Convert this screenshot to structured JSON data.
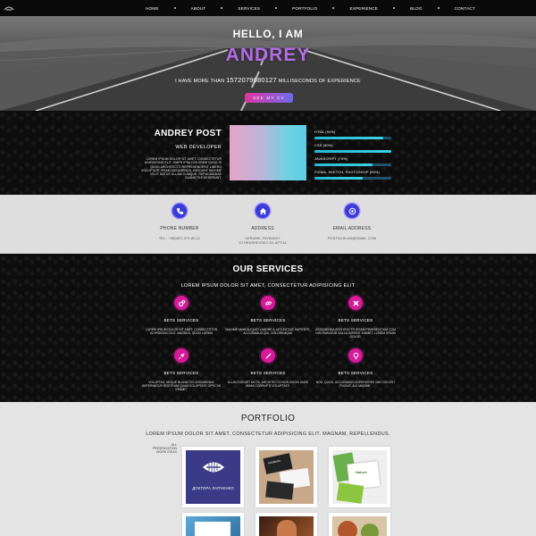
{
  "nav": {
    "items": [
      "HOME",
      "ABOUT",
      "SERVICES",
      "PORTFOLIO",
      "EXPERIENCE",
      "BLOG",
      "CONTACT"
    ]
  },
  "hero": {
    "greeting": "HELLO, I AM",
    "name": "ANDREY",
    "experience_prefix": "I HAVE MORE THAN",
    "experience_number": "1572079080127",
    "experience_suffix": "MILLISECONDS OF EXPERIENCE",
    "cv_button": "SEE MY CV"
  },
  "about": {
    "name": "ANDREY POST",
    "role": "WEB DEVELOPER",
    "text": "LOREM IPSUM DOLOR SIT AMET, CONSECTETUR ADIPISICING ELIT. OMPR IPSA DOLOREM QUOS SI QUOD ARCHITECTO REPREHENDERIT LIBERO VOLUPTATE IPSAM ASSUMENDA, INCIDUNT MAXIME VELIT NATUS ULLAM CUMQUE, REPUDIANDAE BLANDITIIS DESERUNT.",
    "skills": [
      {
        "label": "HTML (90%)",
        "level": 0.9
      },
      {
        "label": "CSS (80%)",
        "level": 1.0
      },
      {
        "label": "JAVASCRIPT (75%)",
        "level": 0.75
      },
      {
        "label": "FIGMA, SKETCH, PHOTOSHOP (90%)",
        "level": 0.63
      }
    ]
  },
  "contact": {
    "items": [
      {
        "title": "PHONE NUMBER",
        "value": "TEL.: +38(067) 079-80-12",
        "icon": "phone-icon"
      },
      {
        "title": "ADDRESS",
        "value": "UKRAINE, RIVNVASY\nST.HRUSHEVSKY 23, APT.34",
        "icon": "home-icon"
      },
      {
        "title": "EMAIL ADDRESS",
        "value": "POSTILKIN.AN@GMAIL.COM",
        "icon": "target-icon"
      }
    ]
  },
  "services": {
    "title": "OUR SERVICES",
    "subtitle": "LOREM IPSUM DOLOR SIT AMET, CONSECTETUR ADIPISICING ELIT",
    "items": [
      {
        "title": "BETS SERVICES",
        "desc": "LOREM IPSUM DOLOR SIT AMET, CONSECTETUR ADIPISICING ELIT. MAGNES, QUOD LOREM",
        "icon": "gears-icon"
      },
      {
        "title": "BETS SERVICES",
        "desc": "MAXIME AMIM ALIQUID LANDRE A, MOLESTIAE SAPIENTE, ACCUSAMUS QUI, OOLOREMQUE",
        "icon": "link-icon"
      },
      {
        "title": "BETS SERVICES",
        "desc": "ASSUMENDA ARCHITECTO IPSAM PRAESENTIUM COM NISI PARIATUR NULLA IMPEDIT ENIMET, LOREM IPSUM DOLOR.",
        "icon": "cross-icon"
      },
      {
        "title": "BETS SERVICES",
        "desc": "VOLUPTAS, NEQUE BLANDITIIS ASSUMENDA ASPERNATUR ROSTRUM QUAM VOLUPTATE OFFICIIS ENIMET.",
        "icon": "rocket-icon"
      },
      {
        "title": "BETS SERVICES",
        "desc": "ILLUM EVENIET DICTA, ARCHITECTO NON DIXON UNDE ANIMI CORRUPTI VOLUPTATE.",
        "icon": "pen-icon"
      },
      {
        "title": "BETS SERVICES",
        "desc": "NOS, QUOD. ACCUSAMUS ASPERIORES SIM CON EST FUGUIT. ALII MAXIME.",
        "icon": "bulb-icon"
      }
    ]
  },
  "portfolio": {
    "title": "PORTFOLIO",
    "subtitle": "LOREM IPSUM DOLOR SIT AMET, CONSECTETUR ADIPISICING ELIT. MAGNAM, REPELLENDUS.",
    "filters": [
      "ALL",
      "PRESENTATION",
      "WORK IDEAS"
    ],
    "cards": [
      {
        "caption": "ДОКТОРА ЛАПЧЕНКО"
      },
      {
        "caption": "Architecto"
      },
      {
        "caption": "Nature"
      },
      {
        "caption": ""
      },
      {
        "caption": ""
      },
      {
        "caption": ""
      }
    ]
  },
  "colors": {
    "accent_pink": "#d51a9a",
    "accent_purple": "#b36be6",
    "accent_blue": "#3b3bd8",
    "skill_cyan": "#2fc6dc"
  }
}
